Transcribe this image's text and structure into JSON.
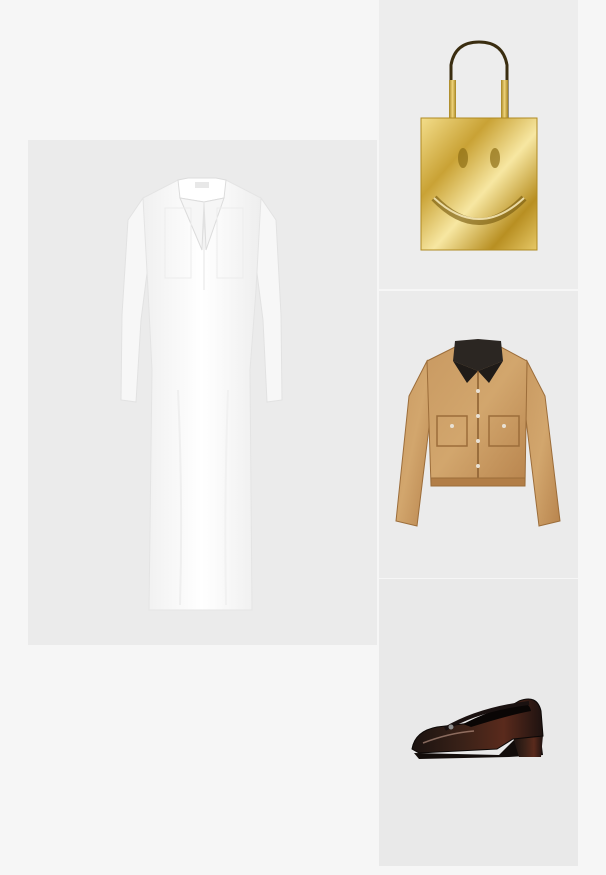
{
  "products": [
    {
      "id": "dress",
      "icon": "white-shirt-dress-image",
      "color": "#ffffff"
    },
    {
      "id": "bag",
      "icon": "gold-smiley-tote-image",
      "color": "#d9b84a"
    },
    {
      "id": "jacket",
      "icon": "tan-suede-jacket-image",
      "color": "#c8955a"
    },
    {
      "id": "shoe",
      "icon": "black-mary-jane-pump-image",
      "color": "#2a1a16"
    }
  ],
  "page": {
    "background": "#f6f6f6"
  }
}
